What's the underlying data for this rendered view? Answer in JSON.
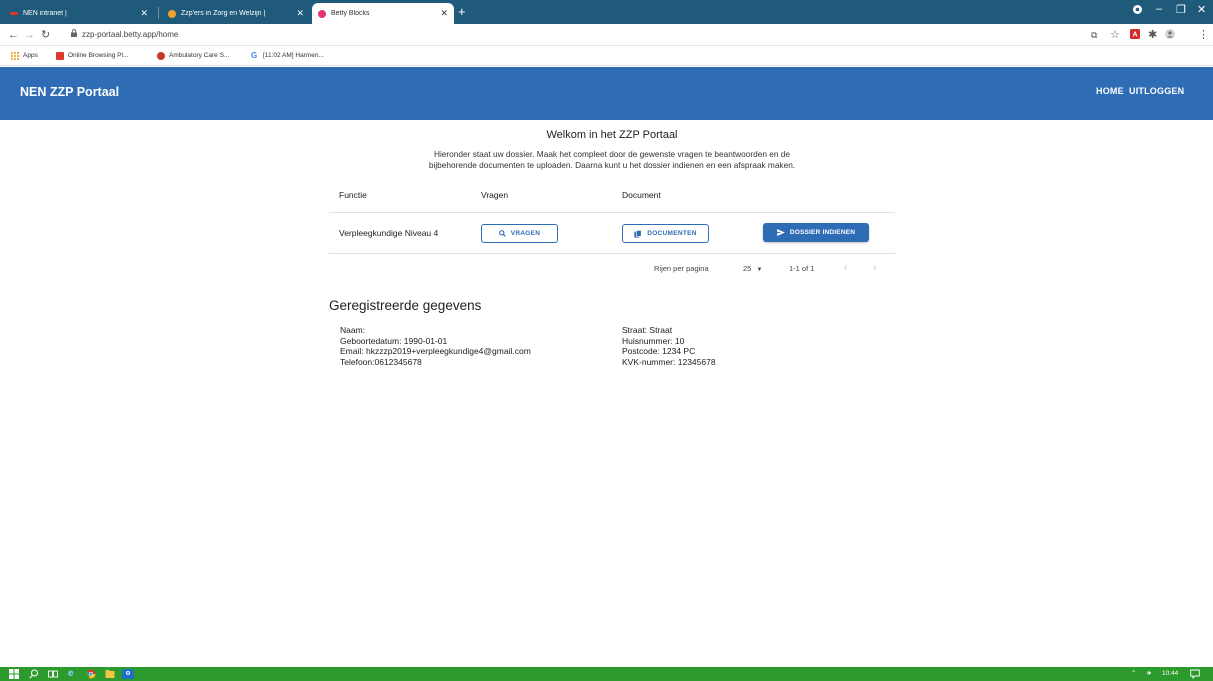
{
  "browser": {
    "tabs": [
      {
        "title": "NEN intranet |",
        "favicon_color": "#e0352b"
      },
      {
        "title": "Zzp'ers in Zorg en Welzijn |",
        "favicon_color": "#f0a030"
      },
      {
        "title": "Betty Blocks",
        "favicon_color": "#e8336b"
      }
    ],
    "new_tab_label": "+",
    "url": "zzp-portaal.betty.app/home",
    "bookmarks": [
      {
        "label": "Apps",
        "icon_color": "#e8a10c"
      },
      {
        "label": "Online Browsing Pl...",
        "icon_color": "#e0352b"
      },
      {
        "label": "Ambulatory Care S...",
        "icon_color": "#c0392b"
      },
      {
        "label": "[11:02 AM] Harmen...",
        "icon_color": "#4285f4"
      }
    ]
  },
  "header": {
    "title": "NEN ZZP Portaal",
    "nav": [
      "HOME",
      "UITLOGGEN"
    ],
    "color": "#2e6cb5"
  },
  "main": {
    "welcome": "Welkom in het ZZP Portaal",
    "intro_line1": "Hieronder staat uw dossier. Maak het compleet door de gewenste vragen te beantwoorden en de",
    "intro_line2": "bijbehorende documenten te uploaden. Daarna kunt u het dossier indienen en een afspraak maken.",
    "table": {
      "headers": [
        "Functie",
        "Vragen",
        "Document"
      ],
      "rows": [
        {
          "functie": "Verpleegkundige Niveau 4",
          "vragen_button": "VRAGEN",
          "documenten_button": "DOCUMENTEN",
          "indienen_button": "DOSSIER INDIENEN"
        }
      ]
    },
    "pagination": {
      "rows_label": "Rijen per pagina",
      "rows_value": "25",
      "range": "1-1 of 1"
    }
  },
  "registered": {
    "title": "Geregistreerde gegevens",
    "left": [
      "Naam:",
      "Geboortedatum: 1990-01-01",
      "Email: hkzzzp2019+verpleegkundige4@gmail.com",
      "Telefoon:0612345678"
    ],
    "right": [
      "Straat: Straat",
      "Huisnummer: 10",
      "Postcode: 1234 PC",
      "KVK-nummer: 12345678"
    ]
  },
  "taskbar": {
    "time": "10:44"
  }
}
